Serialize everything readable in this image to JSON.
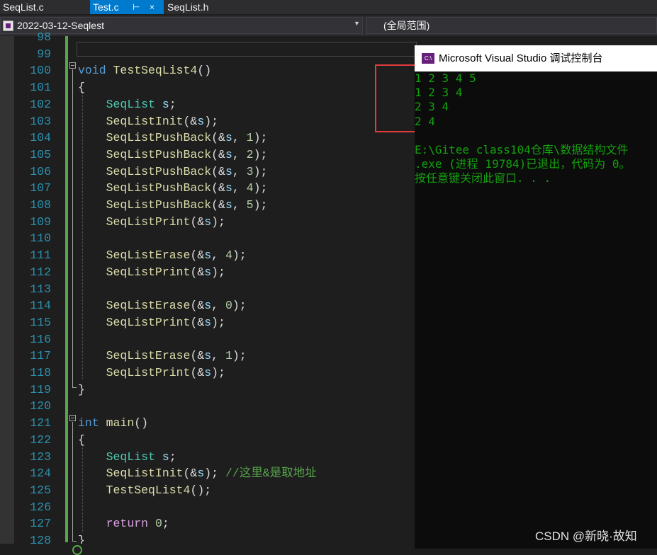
{
  "tabs": [
    {
      "label": "SeqList.c"
    },
    {
      "label": "Test.c",
      "pin_icon": "⊢",
      "close_icon": "×"
    },
    {
      "label": "SeqList.h"
    }
  ],
  "navbar": {
    "project": "2022-03-12-Seqlest",
    "scope": "(全局范围)"
  },
  "editor": {
    "lines": [
      {
        "num": "98"
      },
      {
        "num": "99"
      },
      {
        "num": "100",
        "tokens": [
          [
            "kw",
            "void"
          ],
          [
            "punc",
            " "
          ],
          [
            "fn",
            "TestSeqList4"
          ],
          [
            "punc",
            "()"
          ]
        ]
      },
      {
        "num": "101",
        "tokens": [
          [
            "punc",
            "{"
          ]
        ]
      },
      {
        "num": "102",
        "tokens": [
          [
            "punc",
            "    "
          ],
          [
            "type",
            "SeqList"
          ],
          [
            "punc",
            " "
          ],
          [
            "var",
            "s"
          ],
          [
            "punc",
            ";"
          ]
        ]
      },
      {
        "num": "103",
        "tokens": [
          [
            "punc",
            "    "
          ],
          [
            "fn",
            "SeqListInit"
          ],
          [
            "punc",
            "(&"
          ],
          [
            "var",
            "s"
          ],
          [
            "punc",
            ");"
          ]
        ]
      },
      {
        "num": "104",
        "tokens": [
          [
            "punc",
            "    "
          ],
          [
            "fn",
            "SeqListPushBack"
          ],
          [
            "punc",
            "(&"
          ],
          [
            "var",
            "s"
          ],
          [
            "punc",
            ", "
          ],
          [
            "num",
            "1"
          ],
          [
            "punc",
            ");"
          ]
        ]
      },
      {
        "num": "105",
        "tokens": [
          [
            "punc",
            "    "
          ],
          [
            "fn",
            "SeqListPushBack"
          ],
          [
            "punc",
            "(&"
          ],
          [
            "var",
            "s"
          ],
          [
            "punc",
            ", "
          ],
          [
            "num",
            "2"
          ],
          [
            "punc",
            ");"
          ]
        ]
      },
      {
        "num": "106",
        "tokens": [
          [
            "punc",
            "    "
          ],
          [
            "fn",
            "SeqListPushBack"
          ],
          [
            "punc",
            "(&"
          ],
          [
            "var",
            "s"
          ],
          [
            "punc",
            ", "
          ],
          [
            "num",
            "3"
          ],
          [
            "punc",
            ");"
          ]
        ]
      },
      {
        "num": "107",
        "tokens": [
          [
            "punc",
            "    "
          ],
          [
            "fn",
            "SeqListPushBack"
          ],
          [
            "punc",
            "(&"
          ],
          [
            "var",
            "s"
          ],
          [
            "punc",
            ", "
          ],
          [
            "num",
            "4"
          ],
          [
            "punc",
            ");"
          ]
        ]
      },
      {
        "num": "108",
        "tokens": [
          [
            "punc",
            "    "
          ],
          [
            "fn",
            "SeqListPushBack"
          ],
          [
            "punc",
            "(&"
          ],
          [
            "var",
            "s"
          ],
          [
            "punc",
            ", "
          ],
          [
            "num",
            "5"
          ],
          [
            "punc",
            ");"
          ]
        ]
      },
      {
        "num": "109",
        "tokens": [
          [
            "punc",
            "    "
          ],
          [
            "fn",
            "SeqListPrint"
          ],
          [
            "punc",
            "(&"
          ],
          [
            "var",
            "s"
          ],
          [
            "punc",
            ");"
          ]
        ]
      },
      {
        "num": "110"
      },
      {
        "num": "111",
        "tokens": [
          [
            "punc",
            "    "
          ],
          [
            "fn",
            "SeqListErase"
          ],
          [
            "punc",
            "(&"
          ],
          [
            "var",
            "s"
          ],
          [
            "punc",
            ", "
          ],
          [
            "num",
            "4"
          ],
          [
            "punc",
            ");"
          ]
        ]
      },
      {
        "num": "112",
        "tokens": [
          [
            "punc",
            "    "
          ],
          [
            "fn",
            "SeqListPrint"
          ],
          [
            "punc",
            "(&"
          ],
          [
            "var",
            "s"
          ],
          [
            "punc",
            ");"
          ]
        ]
      },
      {
        "num": "113"
      },
      {
        "num": "114",
        "tokens": [
          [
            "punc",
            "    "
          ],
          [
            "fn",
            "SeqListErase"
          ],
          [
            "punc",
            "(&"
          ],
          [
            "var",
            "s"
          ],
          [
            "punc",
            ", "
          ],
          [
            "num",
            "0"
          ],
          [
            "punc",
            ");"
          ]
        ]
      },
      {
        "num": "115",
        "tokens": [
          [
            "punc",
            "    "
          ],
          [
            "fn",
            "SeqListPrint"
          ],
          [
            "punc",
            "(&"
          ],
          [
            "var",
            "s"
          ],
          [
            "punc",
            ");"
          ]
        ]
      },
      {
        "num": "116"
      },
      {
        "num": "117",
        "tokens": [
          [
            "punc",
            "    "
          ],
          [
            "fn",
            "SeqListErase"
          ],
          [
            "punc",
            "(&"
          ],
          [
            "var",
            "s"
          ],
          [
            "punc",
            ", "
          ],
          [
            "num",
            "1"
          ],
          [
            "punc",
            ");"
          ]
        ]
      },
      {
        "num": "118",
        "tokens": [
          [
            "punc",
            "    "
          ],
          [
            "fn",
            "SeqListPrint"
          ],
          [
            "punc",
            "(&"
          ],
          [
            "var",
            "s"
          ],
          [
            "punc",
            ");"
          ]
        ]
      },
      {
        "num": "119",
        "tokens": [
          [
            "punc",
            "}"
          ]
        ]
      },
      {
        "num": "120"
      },
      {
        "num": "121",
        "tokens": [
          [
            "kw",
            "int"
          ],
          [
            "punc",
            " "
          ],
          [
            "fn",
            "main"
          ],
          [
            "punc",
            "()"
          ]
        ]
      },
      {
        "num": "122",
        "tokens": [
          [
            "punc",
            "{"
          ]
        ]
      },
      {
        "num": "123",
        "tokens": [
          [
            "punc",
            "    "
          ],
          [
            "type",
            "SeqList"
          ],
          [
            "punc",
            " "
          ],
          [
            "var",
            "s"
          ],
          [
            "punc",
            ";"
          ]
        ]
      },
      {
        "num": "124",
        "tokens": [
          [
            "punc",
            "    "
          ],
          [
            "fn",
            "SeqListInit"
          ],
          [
            "punc",
            "(&"
          ],
          [
            "var",
            "s"
          ],
          [
            "punc",
            "); "
          ],
          [
            "cmt",
            "//这里&是取地址"
          ]
        ]
      },
      {
        "num": "125",
        "tokens": [
          [
            "punc",
            "    "
          ],
          [
            "fn",
            "TestSeqList4"
          ],
          [
            "punc",
            "();"
          ]
        ]
      },
      {
        "num": "126"
      },
      {
        "num": "127",
        "tokens": [
          [
            "punc",
            "    "
          ],
          [
            "ctl",
            "return"
          ],
          [
            "punc",
            " "
          ],
          [
            "num",
            "0"
          ],
          [
            "punc",
            ";"
          ]
        ]
      },
      {
        "num": "128",
        "tokens": [
          [
            "punc",
            "}"
          ]
        ]
      }
    ]
  },
  "console": {
    "title": "Microsoft Visual Studio 调试控制台",
    "icon_label": "C:\\",
    "output": [
      "1 2 3 4 5",
      "1 2 3 4",
      "2 3 4",
      "2 4",
      "",
      "E:\\Gitee class104仓库\\数据结构文件",
      ".exe (进程 19784)已退出，代码为 0。",
      "按任意键关闭此窗口. . ."
    ]
  },
  "watermark": "CSDN @新晓·故知",
  "colors": {
    "accent": "#007acc",
    "line_numbers": "#2b91af",
    "console_text": "#13a10e",
    "highlight_box": "#e23c3c"
  }
}
